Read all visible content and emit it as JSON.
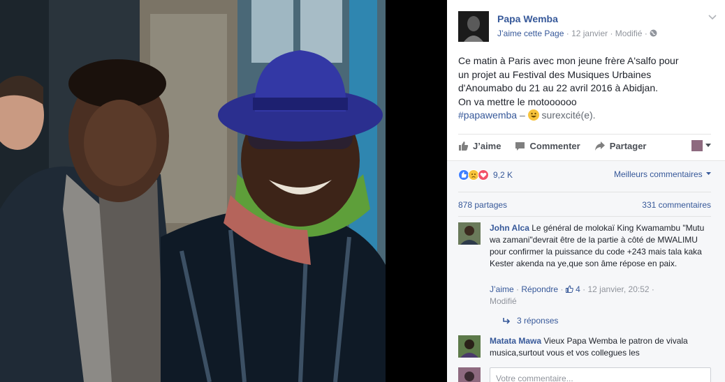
{
  "post": {
    "page_name": "Papa Wemba",
    "like_page": "J’aime cette Page",
    "date": "12 janvier",
    "edited": "Modifié",
    "text_lines": [
      "Ce matin à Paris avec mon jeune frère A'salfo pour",
      "un projet au Festival des Musiques Urbaines",
      "d'Anoumabo du 21 au 22 avril 2016 à Abidjan.",
      "On va mettre le motoooooo"
    ],
    "hashtag": "#papawemba",
    "feeling_sep": "–",
    "feeling": "surexcité(e)."
  },
  "actions": {
    "like": "J’aime",
    "comment": "Commenter",
    "share": "Partager"
  },
  "reactions": {
    "count": "9,2 K",
    "best_comments": "Meilleurs commentaires"
  },
  "stats": {
    "shares": "878 partages",
    "comments": "331 commentaires"
  },
  "comments": [
    {
      "author": "John Alca",
      "text": " Le général de molokaï King Kwamambu \"Mutu wa zamani\"devrait être de la partie à côté de MWALIMU pour confirmer la puissance du code +243 mais tala kaka Kester akenda na ye,que son âme répose en paix.",
      "like": "J’aime",
      "reply": "Répondre",
      "likes": "4",
      "time": "12 janvier, 20:52",
      "edited": "Modifié",
      "replies": "3 réponses"
    },
    {
      "author": "Matata Mawa",
      "text": " Vieux Papa Wemba le patron de vivala musica,surtout vous et vos collegues les"
    }
  ],
  "compose": {
    "placeholder": "Votre commentaire..."
  },
  "colors": {
    "link": "#365899",
    "text": "#1d2129",
    "muted": "#90949c",
    "like_reaction": "#4080ff",
    "love_reaction": "#f25268",
    "sad_reaction": "#f7c33b"
  }
}
